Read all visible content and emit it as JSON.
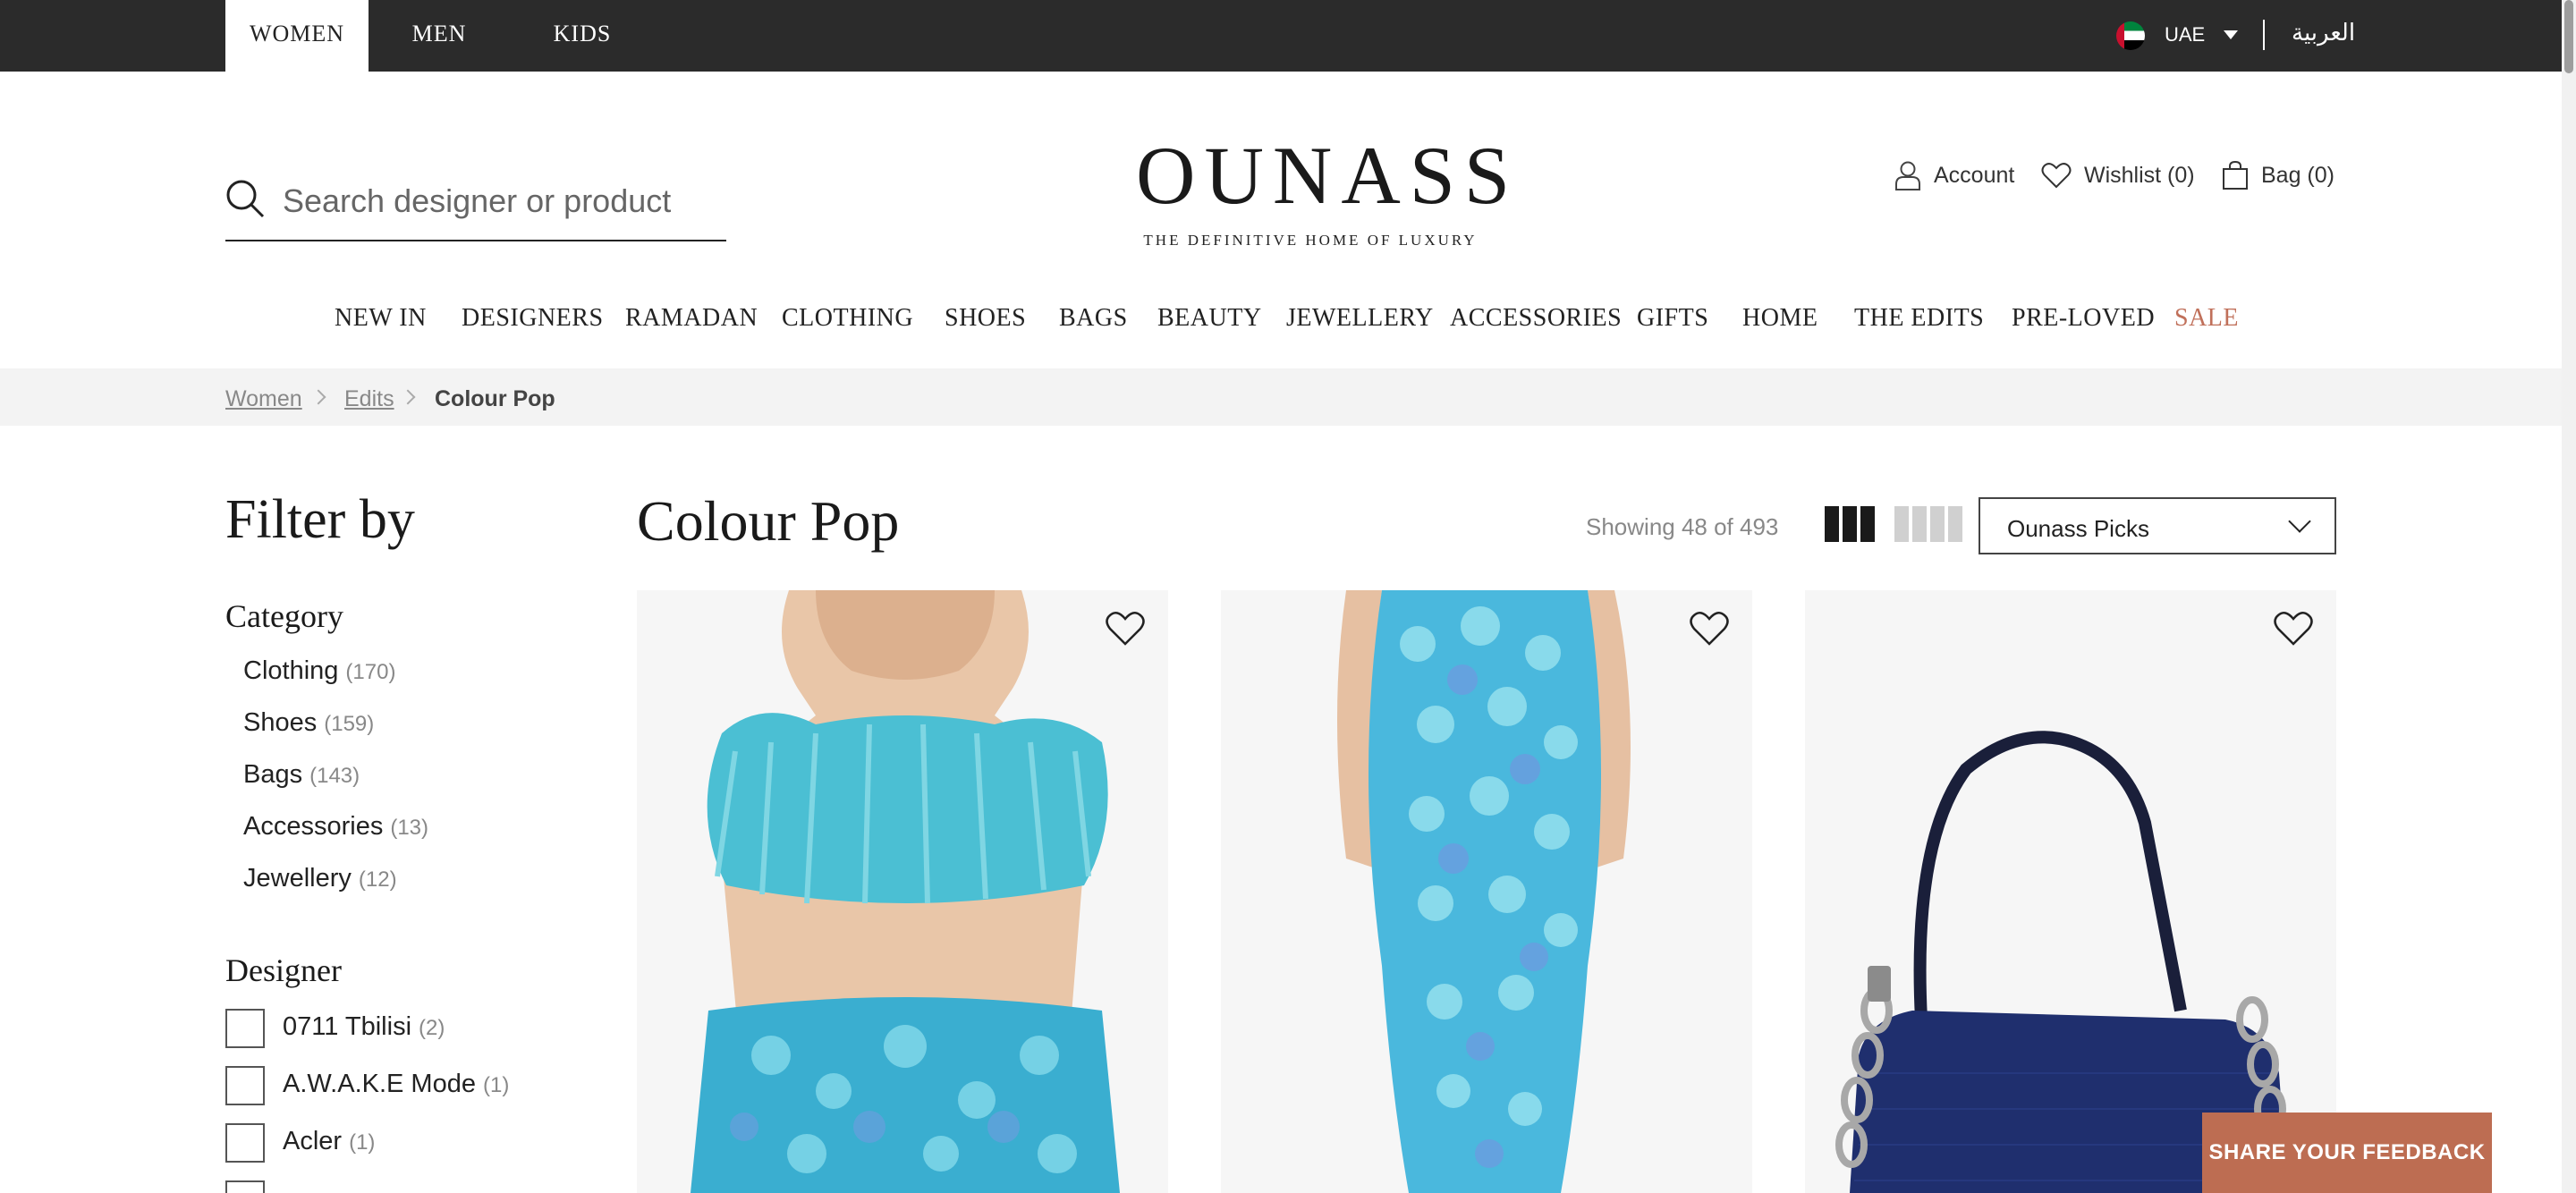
{
  "topbar": {
    "tabs": [
      "WOMEN",
      "MEN",
      "KIDS"
    ],
    "country": "UAE",
    "language": "العربية"
  },
  "header": {
    "search_placeholder": "Search designer or product",
    "logo": "OUNASS",
    "tagline": "THE DEFINITIVE HOME OF LUXURY",
    "account": "Account",
    "wishlist": "Wishlist (0)",
    "bag": "Bag (0)"
  },
  "nav": [
    "NEW IN",
    "DESIGNERS",
    "RAMADAN",
    "CLOTHING",
    "SHOES",
    "BAGS",
    "BEAUTY",
    "JEWELLERY",
    "ACCESSORIES",
    "GIFTS",
    "HOME",
    "THE EDITS",
    "PRE-LOVED",
    "SALE"
  ],
  "breadcrumb": [
    "Women",
    "Edits",
    "Colour Pop"
  ],
  "filters": {
    "title": "Filter by",
    "category": {
      "title": "Category",
      "items": [
        {
          "label": "Clothing",
          "count": "(170)"
        },
        {
          "label": "Shoes",
          "count": "(159)"
        },
        {
          "label": "Bags",
          "count": "(143)"
        },
        {
          "label": "Accessories",
          "count": "(13)"
        },
        {
          "label": "Jewellery",
          "count": "(12)"
        }
      ]
    },
    "designer": {
      "title": "Designer",
      "items": [
        {
          "label": "0711 Tbilisi",
          "count": "(2)"
        },
        {
          "label": "A.W.A.K.E Mode",
          "count": "(1)"
        },
        {
          "label": "Acler",
          "count": "(1)"
        }
      ]
    }
  },
  "listing": {
    "title": "Colour Pop",
    "showing": "Showing 48 of 493",
    "sort": "Ounass Picks"
  },
  "colors": {
    "topbar": "#2b2b2b",
    "sale": "#c0705a",
    "feedback": "#bd6d52",
    "aqua": "#4fc3d9",
    "navy": "#1c2a5c"
  },
  "icons": [
    "search-icon",
    "user-icon",
    "heart-icon",
    "bag-icon",
    "grid-3-icon",
    "grid-4-icon",
    "chevron-down-icon"
  ],
  "feedback": "SHARE YOUR FEEDBACK"
}
